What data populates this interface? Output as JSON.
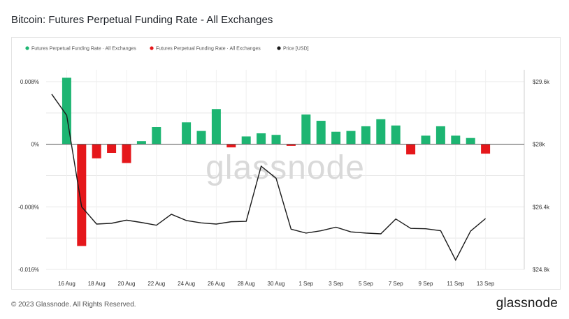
{
  "title": "Bitcoin: Futures Perpetual Funding Rate - All Exchanges",
  "footer": {
    "copyright": "© 2023 Glassnode. All Rights Reserved.",
    "logo_text": "glassnode"
  },
  "watermark": "glassnode",
  "colors": {
    "positive": "#1db572",
    "negative": "#e5171b",
    "price": "#1a1a1a",
    "grid": "#e8e8e8"
  },
  "chart_data": {
    "type": "bar",
    "legend": [
      {
        "label": "Futures Perpetual Funding Rate · All Exchanges",
        "color": "#1db572"
      },
      {
        "label": "Futures Perpetual Funding Rate · All Exchanges",
        "color": "#e5171b"
      },
      {
        "label": "Price [USD]",
        "color": "#1a1a1a"
      }
    ],
    "legend_position": "top-left",
    "x_ticks": [
      "16 Aug",
      "18 Aug",
      "20 Aug",
      "22 Aug",
      "24 Aug",
      "26 Aug",
      "28 Aug",
      "30 Aug",
      "1 Sep",
      "3 Sep",
      "5 Sep",
      "7 Sep",
      "9 Sep",
      "11 Sep",
      "13 Sep"
    ],
    "y_left": {
      "ticks": [
        "0.008%",
        "0%",
        "-0.008%",
        "-0.016%"
      ],
      "values": [
        0.008,
        0,
        -0.008,
        -0.016
      ],
      "range": [
        -0.016,
        0.008
      ]
    },
    "y_right": {
      "ticks": [
        "$29.6k",
        "$28k",
        "$26.4k",
        "$24.8k"
      ],
      "values": [
        29600,
        28000,
        26400,
        24800
      ],
      "range": [
        24800,
        29600
      ]
    },
    "grid": true,
    "dates": [
      "15 Aug",
      "16 Aug",
      "17 Aug",
      "18 Aug",
      "19 Aug",
      "20 Aug",
      "21 Aug",
      "22 Aug",
      "23 Aug",
      "24 Aug",
      "25 Aug",
      "26 Aug",
      "27 Aug",
      "28 Aug",
      "29 Aug",
      "30 Aug",
      "31 Aug",
      "1 Sep",
      "2 Sep",
      "3 Sep",
      "4 Sep",
      "5 Sep",
      "6 Sep",
      "7 Sep",
      "8 Sep",
      "9 Sep",
      "10 Sep",
      "11 Sep",
      "12 Sep",
      "13 Sep",
      "14 Sep"
    ],
    "funding_rate": [
      null,
      0.0085,
      -0.013,
      -0.0018,
      -0.0011,
      -0.0024,
      0.0004,
      0.0022,
      null,
      0.0028,
      0.0017,
      0.0045,
      -0.0004,
      0.001,
      0.0014,
      0.0012,
      -0.0002,
      0.0038,
      0.003,
      0.0016,
      0.0017,
      0.0023,
      0.0032,
      0.0024,
      -0.0013,
      0.0011,
      0.0023,
      0.0011,
      0.0008,
      -0.0012,
      null
    ],
    "price": [
      29280,
      28740,
      26400,
      25960,
      25980,
      26060,
      26000,
      25930,
      26210,
      26050,
      25990,
      25960,
      26020,
      26030,
      27440,
      27130,
      25830,
      25730,
      25790,
      25880,
      25760,
      25730,
      25710,
      26090,
      25850,
      25840,
      25790,
      25040,
      25780,
      26100,
      null
    ]
  }
}
